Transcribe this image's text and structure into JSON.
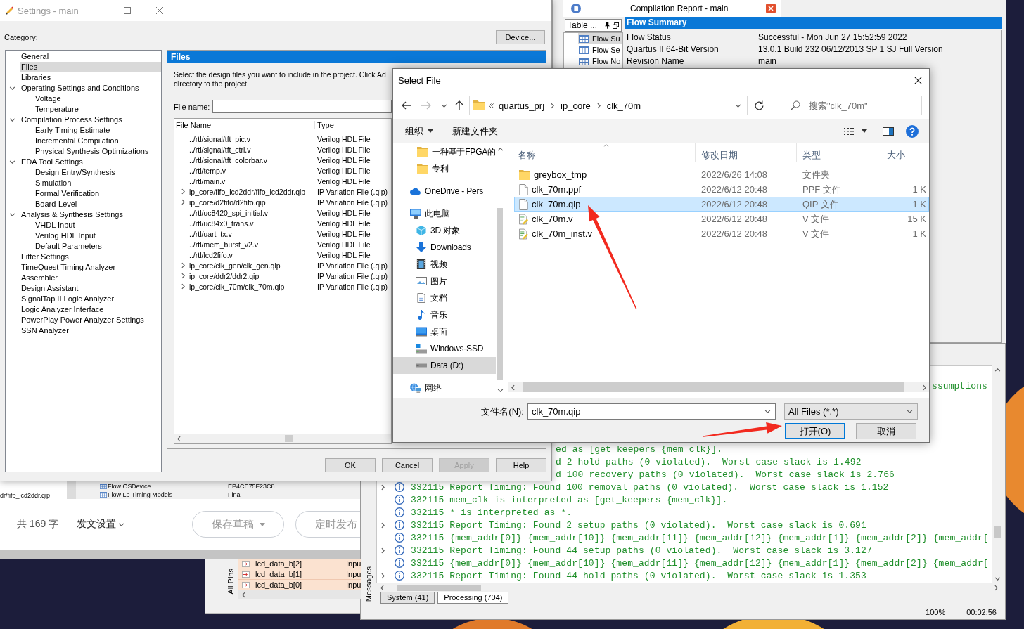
{
  "settings_window": {
    "title": "Settings - main",
    "category_label": "Category:",
    "device_button": "Device...",
    "categories": [
      {
        "label": "General",
        "selected": false,
        "expanded": false
      },
      {
        "label": "Files",
        "selected": true,
        "expanded": false
      },
      {
        "label": "Libraries",
        "selected": false,
        "expanded": false
      },
      {
        "label": "Operating Settings and Conditions",
        "selected": false,
        "expanded": true,
        "children": [
          {
            "label": "Voltage",
            "selected": false,
            "expanded": false
          },
          {
            "label": "Temperature",
            "selected": false,
            "expanded": false
          }
        ]
      },
      {
        "label": "Compilation Process Settings",
        "selected": false,
        "expanded": true,
        "children": [
          {
            "label": "Early Timing Estimate",
            "selected": false,
            "expanded": false
          },
          {
            "label": "Incremental Compilation",
            "selected": false,
            "expanded": false
          },
          {
            "label": "Physical Synthesis Optimizations",
            "selected": false,
            "expanded": false
          }
        ]
      },
      {
        "label": "EDA Tool Settings",
        "selected": false,
        "expanded": true,
        "children": [
          {
            "label": "Design Entry/Synthesis",
            "selected": false,
            "expanded": false
          },
          {
            "label": "Simulation",
            "selected": false,
            "expanded": false
          },
          {
            "label": "Formal Verification",
            "selected": false,
            "expanded": false
          },
          {
            "label": "Board-Level",
            "selected": false,
            "expanded": false
          }
        ]
      },
      {
        "label": "Analysis & Synthesis Settings",
        "selected": false,
        "expanded": true,
        "children": [
          {
            "label": "VHDL Input",
            "selected": false,
            "expanded": false
          },
          {
            "label": "Verilog HDL Input",
            "selected": false,
            "expanded": false
          },
          {
            "label": "Default Parameters",
            "selected": false,
            "expanded": false
          }
        ]
      },
      {
        "label": "Fitter Settings",
        "selected": false,
        "expanded": false
      },
      {
        "label": "TimeQuest Timing Analyzer",
        "selected": false,
        "expanded": false
      },
      {
        "label": "Assembler",
        "selected": false,
        "expanded": false
      },
      {
        "label": "Design Assistant",
        "selected": false,
        "expanded": false
      },
      {
        "label": "SignalTap II Logic Analyzer",
        "selected": false,
        "expanded": false
      },
      {
        "label": "Logic Analyzer Interface",
        "selected": false,
        "expanded": false
      },
      {
        "label": "PowerPlay Power Analyzer Settings",
        "selected": false,
        "expanded": false
      },
      {
        "label": "SSN Analyzer",
        "selected": false,
        "expanded": false
      }
    ],
    "files_page": {
      "header": "Files",
      "description_lines": [
        "Select the design files you want to include in the project. Click Ad",
        "directory to the project."
      ],
      "file_name_label": "File name:",
      "columns": [
        "File Name",
        "Type"
      ],
      "files": [
        {
          "name": "../rtl/signal/tft_pic.v",
          "type": "Verilog HDL File",
          "kind": "file"
        },
        {
          "name": "../rtl/signal/tft_ctrl.v",
          "type": "Verilog HDL File",
          "kind": "file"
        },
        {
          "name": "../rtl/signal/tft_colorbar.v",
          "type": "Verilog HDL File",
          "kind": "file"
        },
        {
          "name": "../rtl/temp.v",
          "type": "Verilog HDL File",
          "kind": "file"
        },
        {
          "name": "../rtl/main.v",
          "type": "Verilog HDL File",
          "kind": "file"
        },
        {
          "name": "ip_core/fifo_lcd2ddr/fifo_lcd2ddr.qip",
          "type": "IP Variation File (.qip)",
          "kind": "group"
        },
        {
          "name": "ip_core/d2fifo/d2fifo.qip",
          "type": "IP Variation File (.qip)",
          "kind": "group"
        },
        {
          "name": "../rtl/uc8420_spi_initial.v",
          "type": "Verilog HDL File",
          "kind": "file"
        },
        {
          "name": "../rtl/uc84x0_trans.v",
          "type": "Verilog HDL File",
          "kind": "file"
        },
        {
          "name": "../rtl/uart_tx.v",
          "type": "Verilog HDL File",
          "kind": "file"
        },
        {
          "name": "../rtl/mem_burst_v2.v",
          "type": "Verilog HDL File",
          "kind": "file"
        },
        {
          "name": "../rtl/lcd2fifo.v",
          "type": "Verilog HDL File",
          "kind": "file"
        },
        {
          "name": "ip_core/clk_gen/clk_gen.qip",
          "type": "IP Variation File (.qip)",
          "kind": "group"
        },
        {
          "name": "ip_core/ddr2/ddr2.qip",
          "type": "IP Variation File (.qip)",
          "kind": "group"
        },
        {
          "name": "ip_core/clk_70m/clk_70m.qip",
          "type": "IP Variation File (.qip)",
          "kind": "group"
        }
      ]
    },
    "buttons": [
      {
        "label": "OK",
        "disabled": false
      },
      {
        "label": "Cancel",
        "disabled": false
      },
      {
        "label": "Apply",
        "disabled": true
      },
      {
        "label": "Help",
        "disabled": false
      }
    ]
  },
  "compilation_report": {
    "title": "Compilation Report - main",
    "toc_title": "Table ...",
    "toc_items": [
      {
        "label": "Flow Su",
        "selected": true
      },
      {
        "label": "Flow Se",
        "selected": false
      },
      {
        "label": "Flow No",
        "selected": false
      }
    ],
    "section_header": "Flow Summary",
    "rows": [
      {
        "key": "Flow Status",
        "value": "Successful - Mon Jun 27 15:52:59 2022"
      },
      {
        "key": "Quartus II 64-Bit Version",
        "value": "13.0.1 Build 232 06/12/2013 SP 1 SJ Full Version"
      },
      {
        "key": "Revision Name",
        "value": "main"
      }
    ]
  },
  "select_file_dialog": {
    "title": "Select File",
    "path": [
      "quartus_prj",
      "ip_core",
      "clk_70m"
    ],
    "search": {
      "placeholder": "搜索\"clk_70m\""
    },
    "toolbar": {
      "organize": "组织",
      "new_folder": "新建文件夹"
    },
    "nav_items": [
      {
        "label": "一种基于FPGA的",
        "kind": "folder",
        "selected": false
      },
      {
        "label": "专利",
        "kind": "folder",
        "selected": false
      },
      {
        "label": "OneDrive - Pers",
        "kind": "cloud",
        "selected": false
      },
      {
        "label": "此电脑",
        "kind": "computer",
        "selected": false,
        "children": [
          {
            "label": "3D 对象",
            "kind": "cube",
            "selected": false
          },
          {
            "label": "Downloads",
            "kind": "download",
            "selected": false
          },
          {
            "label": "视频",
            "kind": "video",
            "selected": false
          },
          {
            "label": "图片",
            "kind": "picture",
            "selected": false
          },
          {
            "label": "文档",
            "kind": "document",
            "selected": false
          },
          {
            "label": "音乐",
            "kind": "music",
            "selected": false
          },
          {
            "label": "桌面",
            "kind": "desktop",
            "selected": false
          },
          {
            "label": "Windows-SSD",
            "kind": "system-drive",
            "selected": false
          },
          {
            "label": "Data (D:)",
            "kind": "drive",
            "selected": true
          }
        ]
      },
      {
        "label": "网络",
        "kind": "network",
        "selected": false
      }
    ],
    "columns": [
      "名称",
      "修改日期",
      "类型",
      "大小"
    ],
    "files": [
      {
        "name": "greybox_tmp",
        "modified": "2022/6/26 14:08",
        "type": "文件夹",
        "kind": "folder",
        "selected": false
      },
      {
        "name": "clk_70m.ppf",
        "modified": "2022/6/12 20:48",
        "type": "PPF 文件",
        "size": "1 K",
        "kind": "file",
        "selected": false
      },
      {
        "name": "clk_70m.qip",
        "modified": "2022/6/12 20:48",
        "type": "QIP 文件",
        "size": "1 K",
        "kind": "file",
        "selected": true
      },
      {
        "name": "clk_70m.v",
        "modified": "2022/6/12 20:48",
        "type": "V 文件",
        "size": "15 K",
        "kind": "script",
        "selected": false
      },
      {
        "name": "clk_70m_inst.v",
        "modified": "2022/6/12 20:48",
        "type": "V 文件",
        "size": "1 K",
        "kind": "script",
        "selected": false
      }
    ],
    "file_name_label": "文件名(N):",
    "file_name_value": "clk_70m.qip",
    "file_type": "All Files (*.*)",
    "buttons": [
      {
        "label": "打开(O)",
        "default": true
      },
      {
        "label": "取消",
        "default": false
      }
    ]
  },
  "messages_panel": {
    "lines": [
      {
        "kind": "tail",
        "text": "ssumptions"
      },
      {
        "kind": "clipped",
        "text": "ed as [get_keepers {mem_clk}]."
      },
      {
        "kind": "clipped",
        "text": "d 2 hold paths (0 violated).  Worst case slack is 1.492"
      },
      {
        "kind": "clipped",
        "text": "d 100 recovery paths (0 violated).  Worst case slack is 2.766"
      },
      {
        "kind": "group",
        "text": "332115 Report Timing: Found 100 removal paths (0 violated).  Worst case slack is 1.152"
      },
      {
        "kind": "info",
        "text": "332115 mem_clk is interpreted as [get_keepers {mem_clk}]."
      },
      {
        "kind": "info",
        "text": "332115 * is interpreted as *."
      },
      {
        "kind": "group",
        "text": "332115 Report Timing: Found 2 setup paths (0 violated).  Worst case slack is 0.691"
      },
      {
        "kind": "info",
        "text": "332115 {mem_addr[0]} {mem_addr[10]} {mem_addr[11]} {mem_addr[12]} {mem_addr[1]} {mem_addr[2]} {mem_addr["
      },
      {
        "kind": "group",
        "text": "332115 Report Timing: Found 44 setup paths (0 violated).  Worst case slack is 3.127"
      },
      {
        "kind": "info",
        "text": "332115 {mem_addr[0]} {mem_addr[10]} {mem_addr[11]} {mem_addr[12]} {mem_addr[1]} {mem_addr[2]} {mem_addr["
      },
      {
        "kind": "group",
        "text": "332115 Report Timing: Found 44 hold paths (0 violated).  Worst case slack is 1.353"
      }
    ],
    "side_tab": "Messages",
    "tabs": [
      {
        "label": "System (41)",
        "selected": false
      },
      {
        "label": "Processing (704)",
        "selected": true
      }
    ],
    "zoom": "100%",
    "elapsed": "00:02:56"
  },
  "pins_panel": {
    "side_tab": "All Pins",
    "rows": [
      {
        "name": "lcd_data_b[2]",
        "direction": "Inpu"
      },
      {
        "name": "lcd_data_b[1]",
        "direction": "Inpu"
      },
      {
        "name": "lcd_data_b[0]",
        "direction": "Inpu"
      }
    ]
  },
  "background_window": {
    "list_item": "dr/fifo_lcd2ddr.qip",
    "flow_rows": [
      {
        "item": "Flow OS",
        "key": "Device",
        "value": "EP4CE75F23C8"
      },
      {
        "item": "Flow Lo",
        "key": "Timing Models",
        "value": "Final"
      }
    ]
  },
  "editor_bar": {
    "word_count": "共 169 字",
    "publish_settings": "发文设置",
    "save_draft": "保存草稿",
    "schedule": "定时发布"
  }
}
